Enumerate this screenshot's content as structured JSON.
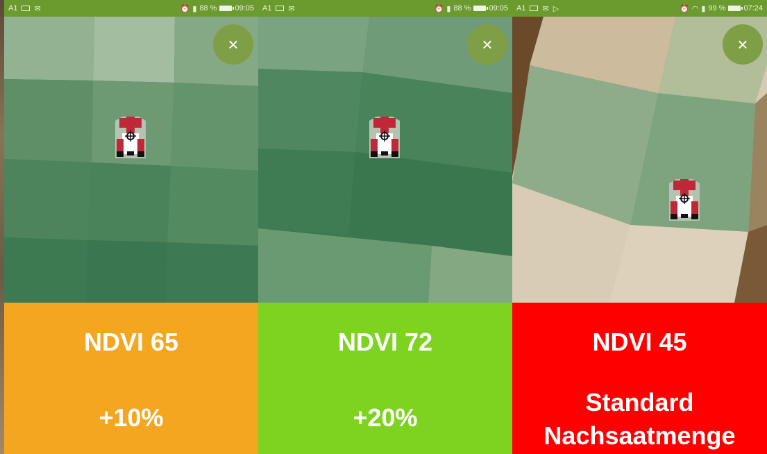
{
  "colors": {
    "status_bar": "#6b9a2e",
    "close_button": "#7f9f46",
    "orange": "#f4a621",
    "green": "#7ed321",
    "red": "#ff0000"
  },
  "panels": [
    {
      "status": {
        "left": "A1",
        "battery": "88 %",
        "time": "09:05"
      },
      "close_icon": "×",
      "ndvi": "NDVI 65",
      "rate": "+10%",
      "color": "#f4a621"
    },
    {
      "status": {
        "left": "A1",
        "battery": "88 %",
        "time": "09:05"
      },
      "close_icon": "×",
      "ndvi": "NDVI 72",
      "rate": "+20%",
      "color": "#7ed321"
    },
    {
      "status": {
        "left": "A1",
        "battery": "99 %",
        "time": "07:24"
      },
      "close_icon": "×",
      "ndvi": "NDVI 45",
      "rate_line1": "Standard",
      "rate_line2": "Nachsaatmenge",
      "color": "#ff0000"
    }
  ]
}
